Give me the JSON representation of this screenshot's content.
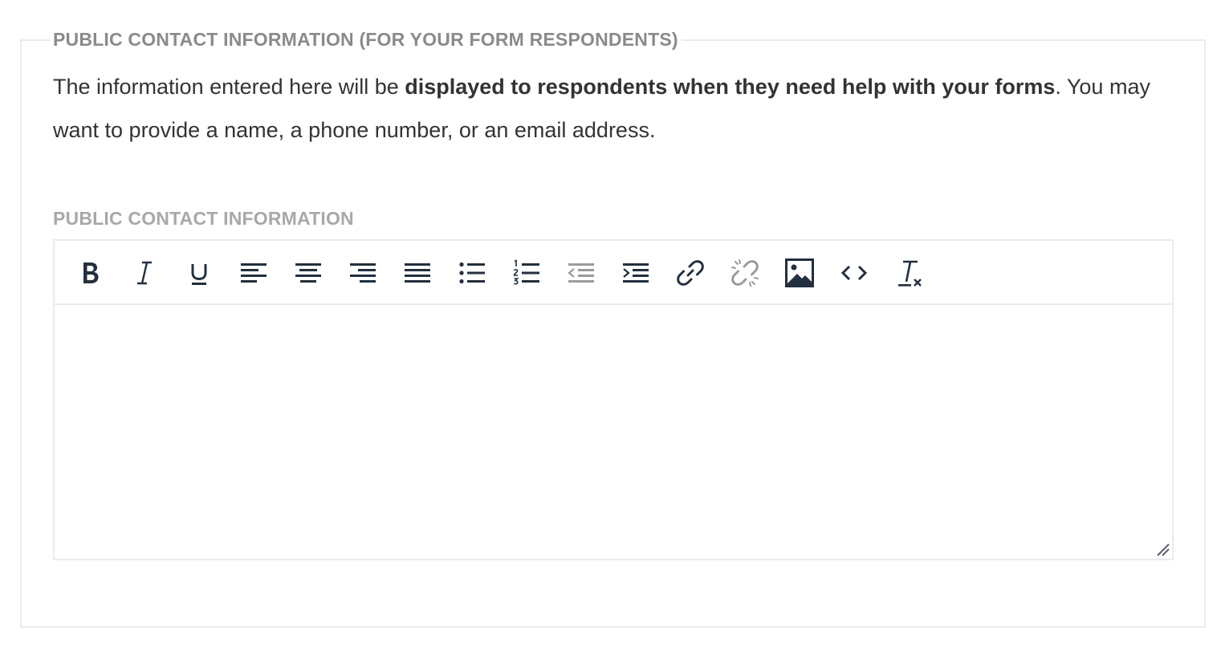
{
  "section": {
    "legend": "PUBLIC CONTACT INFORMATION (FOR YOUR FORM RESPONDENTS)",
    "description_prefix": "The information entered here will be ",
    "description_bold": "displayed to respondents when they need help with your forms",
    "description_suffix": ". You may want to provide a name, a phone number, or an email address."
  },
  "field": {
    "label": "PUBLIC CONTACT INFORMATION",
    "value": ""
  },
  "toolbar": {
    "buttons": [
      {
        "name": "bold",
        "icon": "bold-icon",
        "enabled": true
      },
      {
        "name": "italic",
        "icon": "italic-icon",
        "enabled": true
      },
      {
        "name": "underline",
        "icon": "underline-icon",
        "enabled": true
      },
      {
        "name": "align-left",
        "icon": "align-left-icon",
        "enabled": true
      },
      {
        "name": "align-center",
        "icon": "align-center-icon",
        "enabled": true
      },
      {
        "name": "align-right",
        "icon": "align-right-icon",
        "enabled": true
      },
      {
        "name": "justify",
        "icon": "align-justify-icon",
        "enabled": true
      },
      {
        "name": "bullet-list",
        "icon": "bullet-list-icon",
        "enabled": true
      },
      {
        "name": "numbered-list",
        "icon": "numbered-list-icon",
        "enabled": true
      },
      {
        "name": "outdent",
        "icon": "outdent-icon",
        "enabled": false
      },
      {
        "name": "indent",
        "icon": "indent-icon",
        "enabled": true
      },
      {
        "name": "link",
        "icon": "link-icon",
        "enabled": true
      },
      {
        "name": "unlink",
        "icon": "unlink-icon",
        "enabled": false
      },
      {
        "name": "image",
        "icon": "image-icon",
        "enabled": true
      },
      {
        "name": "source-code",
        "icon": "code-icon",
        "enabled": true
      },
      {
        "name": "clear-formatting",
        "icon": "clear-formatting-icon",
        "enabled": true
      }
    ]
  },
  "colors": {
    "icon_active": "#222f3e",
    "icon_disabled": "#9a9a9a",
    "border": "#ebebeb",
    "legend_text": "#8a8a8a",
    "label_text": "#a8a8a8",
    "body_text": "#333333"
  }
}
